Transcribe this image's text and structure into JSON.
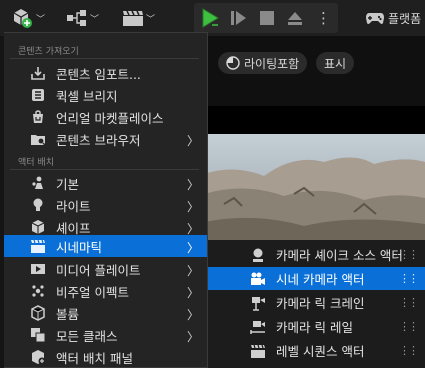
{
  "toolbar": {
    "platform_label": "플랫폼"
  },
  "viewport": {
    "lighting_pill": "라이팅포함",
    "show_pill": "표시"
  },
  "menu": {
    "section_content": "콘텐츠 가져오기",
    "section_actor": "액터 배치",
    "content_items": [
      {
        "label": "콘텐츠 임포트...",
        "icon": "import-icon",
        "submenu": false
      },
      {
        "label": "퀵셀 브리지",
        "icon": "bridge-icon",
        "submenu": false
      },
      {
        "label": "언리얼 마켓플레이스",
        "icon": "marketplace-icon",
        "submenu": false
      },
      {
        "label": "콘텐츠 브라우저",
        "icon": "folder-icon",
        "submenu": true
      }
    ],
    "actor_items": [
      {
        "label": "기본",
        "icon": "basic-actor-icon",
        "submenu": true
      },
      {
        "label": "라이트",
        "icon": "light-bulb-icon",
        "submenu": true
      },
      {
        "label": "셰이프",
        "icon": "cube-icon",
        "submenu": true
      },
      {
        "label": "시네마틱",
        "icon": "clapperboard-icon",
        "submenu": true,
        "active": true
      },
      {
        "label": "미디어 플레이트",
        "icon": "media-plate-icon",
        "submenu": true
      },
      {
        "label": "비주얼 이펙트",
        "icon": "sparkle-icon",
        "submenu": true
      },
      {
        "label": "볼륨",
        "icon": "volume-icon",
        "submenu": true
      },
      {
        "label": "모든 클래스",
        "icon": "classes-icon",
        "submenu": true
      },
      {
        "label": "액터 배치 패널",
        "icon": "place-panel-icon",
        "submenu": false
      }
    ]
  },
  "submenu": {
    "items": [
      {
        "label": "카메라 셰이크 소스 액터",
        "icon": "camera-shake-icon"
      },
      {
        "label": "시네 카메라 액터",
        "icon": "cine-camera-icon",
        "active": true
      },
      {
        "label": "카메라 릭 크레인",
        "icon": "rig-crane-icon"
      },
      {
        "label": "카메라 릭 레일",
        "icon": "rig-rail-icon"
      },
      {
        "label": "레벨 시퀀스 액터",
        "icon": "level-sequence-icon"
      }
    ]
  },
  "colors": {
    "accent": "#0a70d8",
    "play_green": "#3fbf3f",
    "add_green": "#36b34a"
  }
}
